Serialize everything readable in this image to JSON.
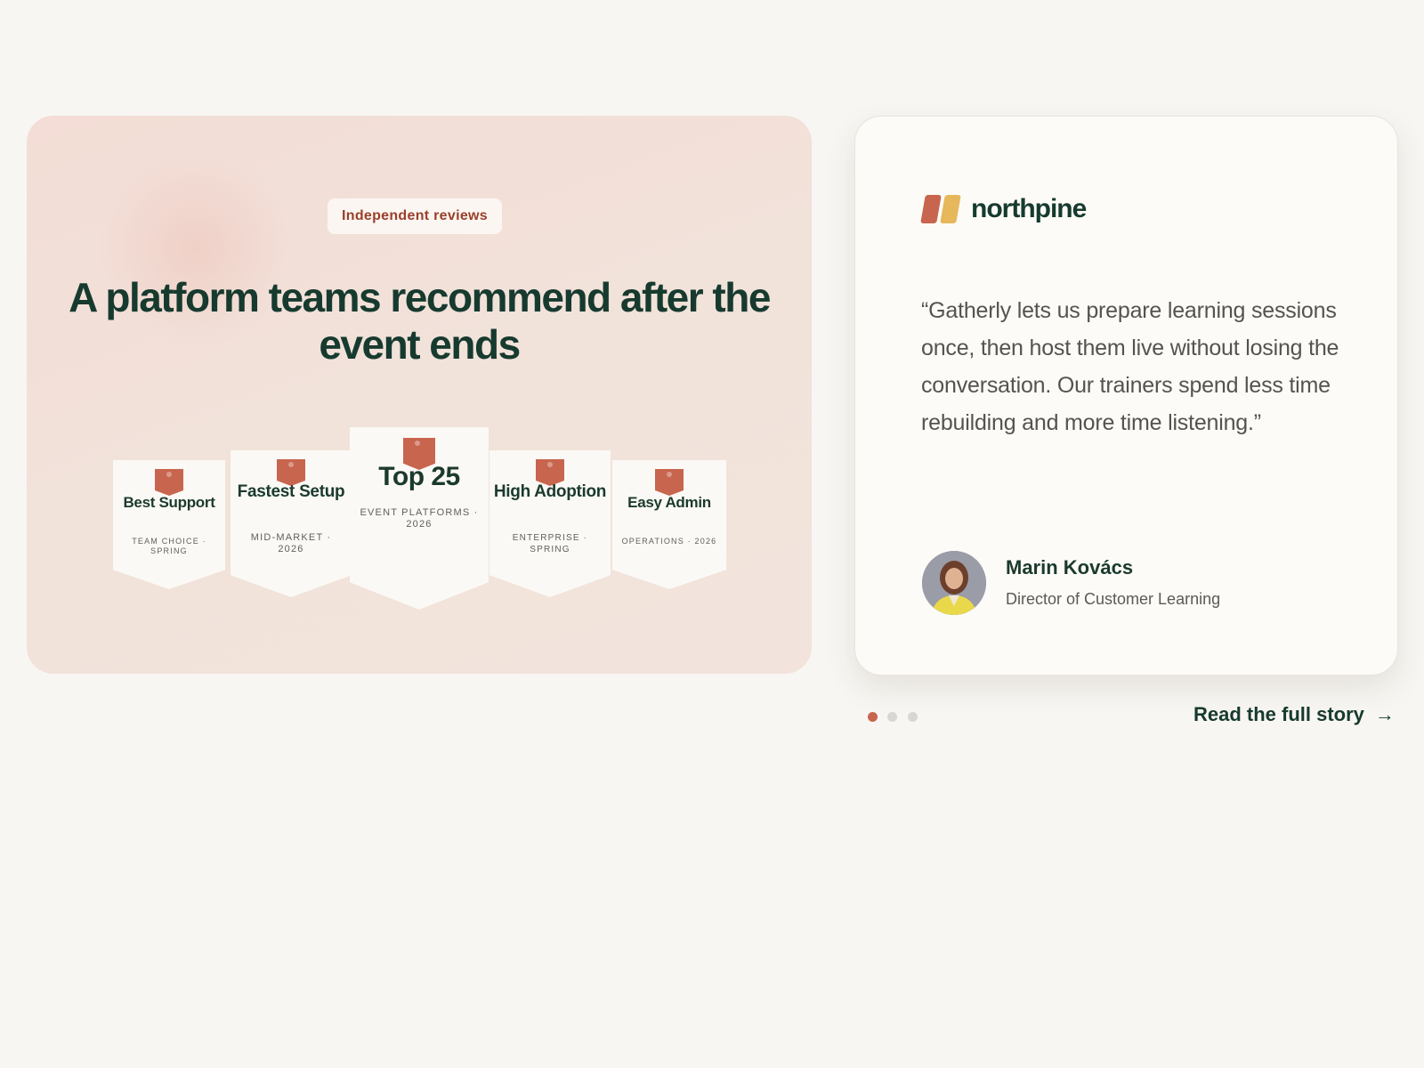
{
  "hero": {
    "pill_label": "Independent reviews",
    "headline": "A platform teams recommend after the event ends",
    "badges": [
      {
        "title": "Best Support",
        "subtitle": "TEAM CHOICE · SPRING"
      },
      {
        "title": "Fastest Setup",
        "subtitle": "MID-MARKET · 2026"
      },
      {
        "title": "Top 25",
        "subtitle": "EVENT PLATFORMS · 2026"
      },
      {
        "title": "High Adoption",
        "subtitle": "ENTERPRISE · SPRING"
      },
      {
        "title": "Easy Admin",
        "subtitle": "OPERATIONS · 2026"
      }
    ]
  },
  "testimonial": {
    "company": "northpine",
    "logo_icon": "northpine-logo-icon",
    "quote": "“Gatherly lets us prepare learning sessions once, then host them live without losing the conversation. Our trainers spend less time rebuilding and more time listening.”",
    "person_name": "Marin Kovács",
    "person_role": "Director of Customer Learning",
    "avatar_icon": "avatar-photo"
  },
  "carousel": {
    "total": 3,
    "active_index": 0
  },
  "cta": {
    "label": "Read the full story",
    "icon": "arrow-right-icon"
  },
  "colors": {
    "accent": "#c8654e",
    "accent_secondary": "#e7b75c",
    "text_dark": "#173a2f",
    "page_bg": "#f8f6f2"
  }
}
